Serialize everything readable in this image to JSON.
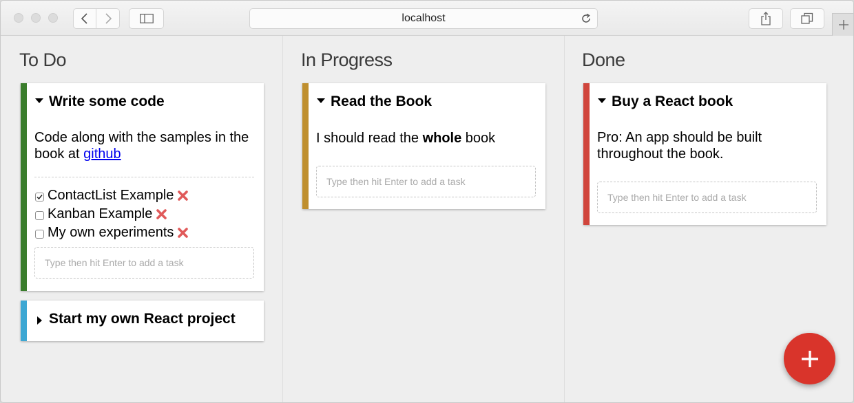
{
  "browser": {
    "address": "localhost"
  },
  "board": {
    "lists": [
      {
        "title": "To Do",
        "cards": [
          {
            "title": "Write some code",
            "expanded": true,
            "color": "#3a7d2c",
            "description_text": "Code along with the samples in the book at ",
            "description_link": "github",
            "tasks": [
              {
                "name": "ContactList Example",
                "done": true
              },
              {
                "name": "Kanban Example",
                "done": false
              },
              {
                "name": "My own experiments",
                "done": false
              }
            ],
            "input_placeholder": "Type then hit Enter to add a task"
          },
          {
            "title": "Start my own React project",
            "expanded": false,
            "color": "#3da7d3"
          }
        ]
      },
      {
        "title": "In Progress",
        "cards": [
          {
            "title": "Read the Book",
            "expanded": true,
            "color": "#bf8f2e",
            "description_before": "I should read the ",
            "description_bold": "whole",
            "description_after": " book",
            "input_placeholder": "Type then hit Enter to add a task"
          }
        ]
      },
      {
        "title": "Done",
        "cards": [
          {
            "title": "Buy a React book",
            "expanded": true,
            "color": "#d0453c",
            "description_text": "Pro: An app should be built throughout the book.",
            "input_placeholder": "Type then hit Enter to add a task"
          }
        ]
      }
    ]
  },
  "fab": {
    "icon": "plus-icon",
    "color": "#d9342b"
  },
  "colors": {
    "remove": "#e05a5a"
  }
}
